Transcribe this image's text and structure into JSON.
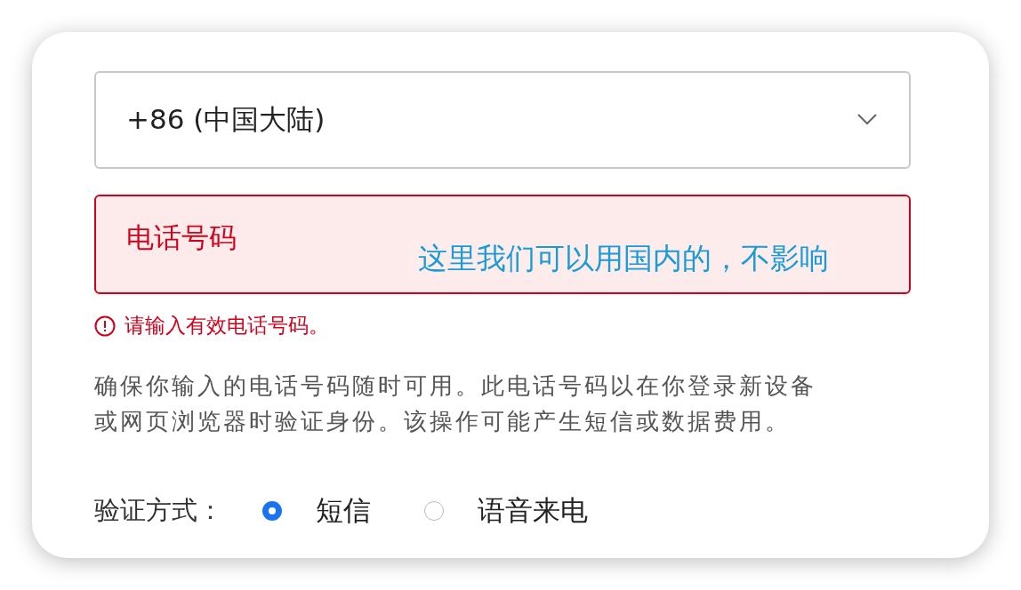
{
  "country_select": {
    "value": "+86 (中国大陆)"
  },
  "phone_field": {
    "placeholder": "电话号码",
    "invalid": true
  },
  "annotation": "这里我们可以用国内的，不影响",
  "error": "请输入有效电话号码。",
  "description": "确保你输入的电话号码随时可用。此电话号码以在你登录新设备或网页浏览器时验证身份。该操作可能产生短信或数据费用。",
  "verification": {
    "label": "验证方式：",
    "options": [
      {
        "label": "短信",
        "selected": true
      },
      {
        "label": "语音来电",
        "selected": false
      }
    ]
  }
}
